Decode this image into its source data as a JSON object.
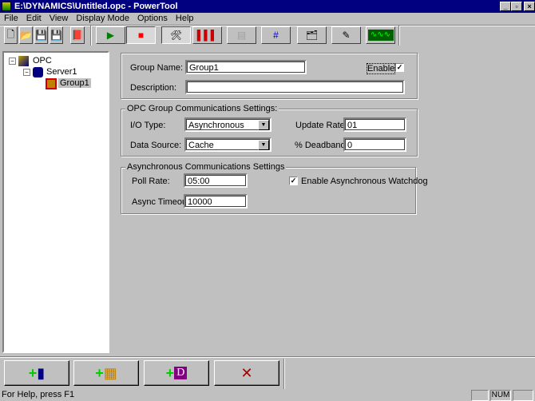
{
  "window": {
    "title": "E:\\DYNAMICS\\Untitled.opc - PowerTool",
    "min": "_",
    "max": "▫",
    "close": "×"
  },
  "menu": [
    "File",
    "Edit",
    "View",
    "Display Mode",
    "Options",
    "Help"
  ],
  "tree": {
    "root": "OPC",
    "server": "Server1",
    "group": "Group1"
  },
  "form": {
    "group_name_label": "Group Name:",
    "group_name": "Group1",
    "enable_label": "Enable",
    "enable_checked": true,
    "description_label": "Description:",
    "description": "",
    "comm_legend": "OPC Group Communications Settings:",
    "io_type_label": "I/O Type:",
    "io_type": "Asynchronous",
    "data_source_label": "Data Source:",
    "data_source": "Cache",
    "update_rate_label": "Update Rate:",
    "update_rate": "01",
    "deadband_label": "% Deadband:",
    "deadband": "0",
    "async_legend": "Asynchronous Communications Settings",
    "poll_rate_label": "Poll Rate:",
    "poll_rate": "05:00",
    "async_timeout_label": "Async Timeout:",
    "async_timeout": "10000",
    "watchdog_label": "Enable Asynchronous Watchdog",
    "watchdog_checked": true
  },
  "status": {
    "help": "For Help, press F1",
    "num": "NUM"
  }
}
